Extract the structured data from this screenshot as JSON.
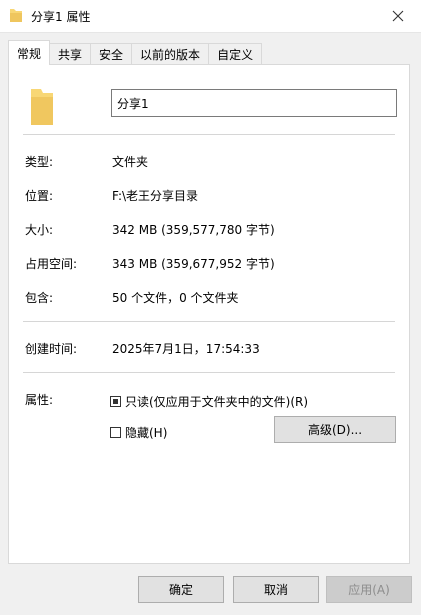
{
  "window": {
    "title": "分享1 属性",
    "close_icon": "close-icon"
  },
  "tabs": [
    {
      "label": "常规",
      "active": true
    },
    {
      "label": "共享",
      "active": false
    },
    {
      "label": "安全",
      "active": false
    },
    {
      "label": "以前的版本",
      "active": false
    },
    {
      "label": "自定义",
      "active": false
    }
  ],
  "general": {
    "folder_name": "分享1",
    "type_label": "类型:",
    "type_value": "文件夹",
    "location_label": "位置:",
    "location_value": "F:\\老王分享目录",
    "size_label": "大小:",
    "size_value": "342 MB (359,577,780 字节)",
    "disk_size_label": "占用空间:",
    "disk_size_value": "343 MB (359,677,952 字节)",
    "contains_label": "包含:",
    "contains_value": "50 个文件，0 个文件夹",
    "created_label": "创建时间:",
    "created_value": "2025年7月1日，17:54:33",
    "attributes_label": "属性:",
    "readonly_label": "只读(仅应用于文件夹中的文件)(R)",
    "readonly_state": "indeterminate",
    "hidden_label": "隐藏(H)",
    "hidden_state": "unchecked",
    "advanced_button": "高级(D)..."
  },
  "footer": {
    "ok": "确定",
    "cancel": "取消",
    "apply": "应用(A)"
  },
  "colors": {
    "folder_yellow": "#f8d775",
    "folder_shade": "#e8b84a",
    "window_bg": "#f0f0f0",
    "panel_bg": "#ffffff"
  }
}
